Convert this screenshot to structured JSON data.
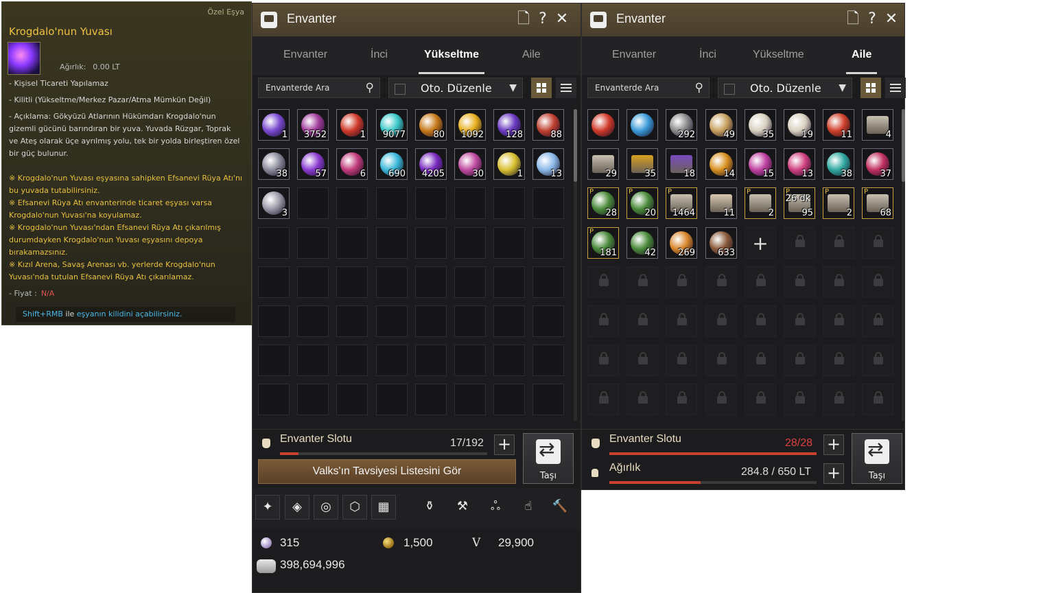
{
  "tooltip": {
    "type": "Özel Eşya",
    "title": "Krogdalo'nun Yuvası",
    "weight_label": "Ağırlık:",
    "weight_value": "0.00 LT",
    "lines": [
      "- Kişisel Ticareti Yapılamaz",
      "- Kilitli (Yükseltme/Merkez Pazar/Atma Mümkün Değil)",
      "- Açıklama: Gökyüzü Atlarının Hükümdarı Krogdalo'nun gizemli gücünü barındıran bir yuva. Yuvada Rüzgar, Toprak ve Ateş olarak üçe ayrılmış yolu, tek bir yolda birleştiren özel bir güç bulunur."
    ],
    "notes": [
      "※ Krogdalo'nun Yuvası eşyasına sahipken Efsanevi Rüya Atı'nı bu yuvada tutabilirsiniz.",
      "※ Efsanevi Rüya Atı envanterinde ticaret eşyası varsa Krogdalo'nun Yuvası'na koyulamaz.",
      "※ Krogdalo'nun Yuvası'ndan Efsanevi Rüya Atı çıkarılmış durumdayken Krogdalo'nun Yuvası eşyasını depoya bırakamazsınız.",
      "※ Kızıl Arena, Savaş Arenası vb. yerlerde Krogdalo'nun Yuvası'nda tutulan Efsanevi Rüya Atı çıkarılamaz."
    ],
    "price_label": "- Fiyat :",
    "price_value": "N/A",
    "hint_key": "Shift+RMB",
    "hint_mid": " ile ",
    "hint_rest": "eşyanın kilidini açabilirsiniz."
  },
  "left": {
    "title": "Envanter",
    "tabs": [
      "Envanter",
      "İnci",
      "Yükseltme",
      "Aile"
    ],
    "active_tab": 2,
    "search_placeholder": "Envanterde Ara",
    "sort_label": "Oto. Düzenle",
    "items": [
      {
        "c": "1",
        "col": "#7a4ad0"
      },
      {
        "c": "3752",
        "col": "#a03a9a"
      },
      {
        "c": "1",
        "col": "#d03a2a"
      },
      {
        "c": "9077",
        "col": "#3ac8c8"
      },
      {
        "c": "80",
        "col": "#c87a1a"
      },
      {
        "c": "1092",
        "col": "#e8b020"
      },
      {
        "c": "128",
        "col": "#6a3ac0"
      },
      {
        "c": "88",
        "col": "#c04030"
      },
      {
        "c": "38",
        "col": "#8a8a9a"
      },
      {
        "c": "57",
        "col": "#8a3ad0"
      },
      {
        "c": "6",
        "col": "#c03a7a"
      },
      {
        "c": "690",
        "col": "#3ab8d8"
      },
      {
        "c": "4205",
        "col": "#7a2ac0"
      },
      {
        "c": "30",
        "col": "#c04aa0"
      },
      {
        "c": "1",
        "col": "#d8c030"
      },
      {
        "c": "13",
        "col": "#8ab8e8"
      },
      {
        "c": "3",
        "col": "#9a9aa8"
      }
    ],
    "slot_label": "Envanter Slotu",
    "slot_value": "17/192",
    "slot_fill": 0.09,
    "move_label": "Taşı",
    "valks_label": "Valks'ın Tavsiyesi Listesini Gör",
    "tools": [
      "wand-icon",
      "gem-plus-icon",
      "ring-icon",
      "crystal-icon",
      "grid-icon",
      "lantern-icon",
      "hammer-icon",
      "swirl-icon",
      "hand-icon",
      "mallet-icon"
    ],
    "pearl": "315",
    "coin": "1,500",
    "v_label": "V",
    "v_value": "29,900",
    "silver": "398,694,996"
  },
  "right": {
    "title": "Envanter",
    "tabs": [
      "Envanter",
      "İnci",
      "Yükseltme",
      "Aile"
    ],
    "active_tab": 3,
    "search_placeholder": "Envanterde Ara",
    "sort_label": "Oto. Düzenle",
    "items": [
      {
        "c": "",
        "col": "#d03a2a",
        "t": "gem"
      },
      {
        "c": "",
        "col": "#3a9ad8",
        "t": "gem"
      },
      {
        "c": "292",
        "col": "#8a8a8a",
        "t": "gem"
      },
      {
        "c": "49",
        "col": "#c8a060",
        "t": "gem"
      },
      {
        "c": "35",
        "col": "#d8d0c0",
        "t": "gem"
      },
      {
        "c": "19",
        "col": "#d8d0c0",
        "t": "gem"
      },
      {
        "c": "11",
        "col": "#d0402a",
        "t": "gem"
      },
      {
        "c": "4",
        "col": "#c8c0b0",
        "t": "scroll"
      },
      {
        "c": "29",
        "col": "#c8c0b0",
        "t": "scroll"
      },
      {
        "c": "35",
        "col": "#d8a020",
        "t": "scroll"
      },
      {
        "c": "18",
        "col": "#7a4ac0",
        "t": "scroll"
      },
      {
        "c": "14",
        "col": "#d89020",
        "t": "gem"
      },
      {
        "c": "15",
        "col": "#c040a0",
        "t": "gem"
      },
      {
        "c": "13",
        "col": "#d04080",
        "t": "gem"
      },
      {
        "c": "38",
        "col": "#30a8a0",
        "t": "gem"
      },
      {
        "c": "37",
        "col": "#c03060",
        "t": "gem"
      },
      {
        "c": "28",
        "col": "#4a8a3a",
        "t": "gem",
        "p": "P"
      },
      {
        "c": "20",
        "col": "#4a8a3a",
        "t": "gem",
        "p": "P"
      },
      {
        "c": "1464",
        "col": "#c8c0b0",
        "t": "scroll",
        "p": "P"
      },
      {
        "c": "11",
        "col": "#d8c8b0",
        "t": "scroll"
      },
      {
        "c": "2",
        "col": "#c8c0b0",
        "t": "scroll",
        "p": "P"
      },
      {
        "c": "95",
        "col": "#c8c0b0",
        "t": "scroll",
        "p": "P",
        "tag": "26 dk"
      },
      {
        "c": "2",
        "col": "#c8c0b0",
        "t": "scroll",
        "p": "P"
      },
      {
        "c": "68",
        "col": "#c8c0b0",
        "t": "scroll",
        "p": "P"
      },
      {
        "c": "181",
        "col": "#4a8a3a",
        "t": "gem",
        "p": "P"
      },
      {
        "c": "42",
        "col": "#4a8a3a",
        "t": "gem"
      },
      {
        "c": "269",
        "col": "#d8862a",
        "t": "gem"
      },
      {
        "c": "633",
        "col": "#8a5a3a",
        "t": "gem"
      }
    ],
    "slot_label": "Envanter Slotu",
    "slot_value": "28/28",
    "slot_fill": 1.0,
    "weight_label": "Ağırlık",
    "weight_value": "284.8 / 650 LT",
    "weight_fill": 0.44,
    "move_label": "Taşı"
  },
  "colors": {
    "accent_brown": "#5a4d36",
    "danger": "#e04040",
    "gold": "#f0c040"
  }
}
